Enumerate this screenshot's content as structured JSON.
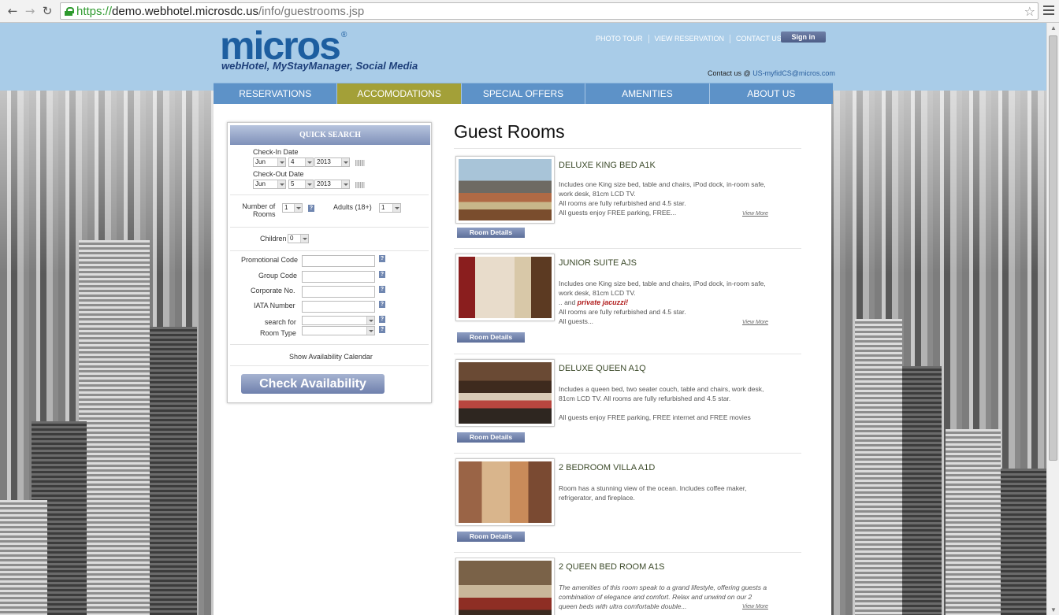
{
  "browser": {
    "url_scheme": "https://",
    "url_host": "demo.webhotel.microsdc.us",
    "url_path": "/info/guestrooms.jsp"
  },
  "header": {
    "logo": "micros",
    "logo_mark": "®",
    "tagline": "webHotel, MyStayManager, Social Media",
    "links": [
      "PHOTO TOUR",
      "VIEW RESERVATION",
      "CONTACT US"
    ],
    "signin": "Sign in",
    "contact_prefix": "Contact us @",
    "contact_email": "US-myfidCS@micros.com"
  },
  "nav": {
    "items": [
      "RESERVATIONS",
      "ACCOMODATIONS",
      "SPECIAL OFFERS",
      "AMENITIES",
      "ABOUT US"
    ],
    "active": "ACCOMODATIONS"
  },
  "quick_search": {
    "title": "QUICK SEARCH",
    "checkin_label": "Check-In Date",
    "checkin": {
      "month": "Jun",
      "day": "4",
      "year": "2013"
    },
    "checkout_label": "Check-Out Date",
    "checkout": {
      "month": "Jun",
      "day": "5",
      "year": "2013"
    },
    "rooms_label_1": "Number of",
    "rooms_label_2": "Rooms",
    "rooms_value": "1",
    "adults_label": "Adults (18+)",
    "adults_value": "1",
    "children_label": "Children",
    "children_value": "0",
    "promo_label": "Promotional Code",
    "group_label": "Group Code",
    "corporate_label": "Corporate No.",
    "iata_label": "IATA Number",
    "search_for_label_1": "search for",
    "search_for_label_2": "Room Type",
    "help_glyph": "?",
    "show_calendar": "Show Availability Calendar",
    "check_button": "Check Availability"
  },
  "main": {
    "title": "Guest Rooms",
    "details_label": "Room Details",
    "view_more": "View More",
    "rooms": [
      {
        "name": "DELUXE KING BED A1K",
        "lines": [
          "Includes one King size bed, table and chairs, iPod dock, in-room safe, work desk, 81cm LCD TV.",
          "All rooms are fully refurbished and 4.5 star.",
          "All guests enjoy FREE parking, FREE..."
        ]
      },
      {
        "name": "JUNIOR SUITE AJS",
        "lines": [
          "Includes one King size bed, table and chairs, iPod dock, in-room safe, work desk, 81cm LCD TV.",
          ".. and",
          "private jacuzzi!",
          "All rooms are fully refurbished and 4.5 star.",
          "All guests..."
        ]
      },
      {
        "name": "DELUXE QUEEN A1Q",
        "lines": [
          "Includes a queen bed, two seater couch, table and chairs, work desk, 81cm LCD TV. All rooms are fully refurbished and 4.5 star.",
          "All guests enjoy FREE parking, FREE internet and FREE movies"
        ]
      },
      {
        "name": "2 BEDROOM VILLA A1D",
        "lines": [
          "Room has a stunning view of the ocean. Includes coffee maker, refrigerator, and fireplace."
        ]
      },
      {
        "name": "2 QUEEN BED ROOM A1S",
        "lines": [
          "The amenities of this room speak to a grand lifestyle, offering guests a combination of elegance and comfort. Relax and unwind on our 2 queen beds with ultra comfortable double..."
        ]
      }
    ]
  }
}
